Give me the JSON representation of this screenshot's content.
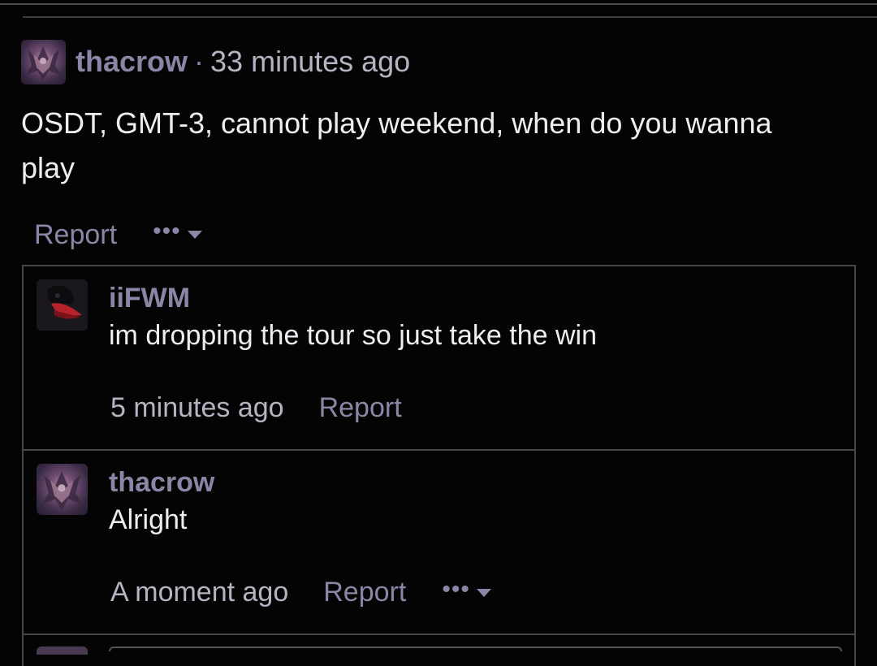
{
  "thread": {
    "comment": {
      "username": "thacrow",
      "separator": "·",
      "time": "33 minutes ago",
      "body": "OSDT, GMT-3, cannot play weekend, when do you wanna play",
      "report_label": "Report",
      "more_label": "•••"
    },
    "replies": [
      {
        "username": "iiFWM",
        "body": "im dropping the tour so just take the win",
        "time": "5 minutes ago",
        "report_label": "Report"
      },
      {
        "username": "thacrow",
        "body": "Alright",
        "time": "A moment ago",
        "report_label": "Report",
        "more_label": "•••"
      }
    ]
  },
  "icons": {
    "more": "more-dots-icon",
    "caret": "caret-down-icon"
  },
  "colors": {
    "background": "#050405",
    "username": "#8c86a6",
    "text": "#eeeef2",
    "border": "#47464c"
  }
}
